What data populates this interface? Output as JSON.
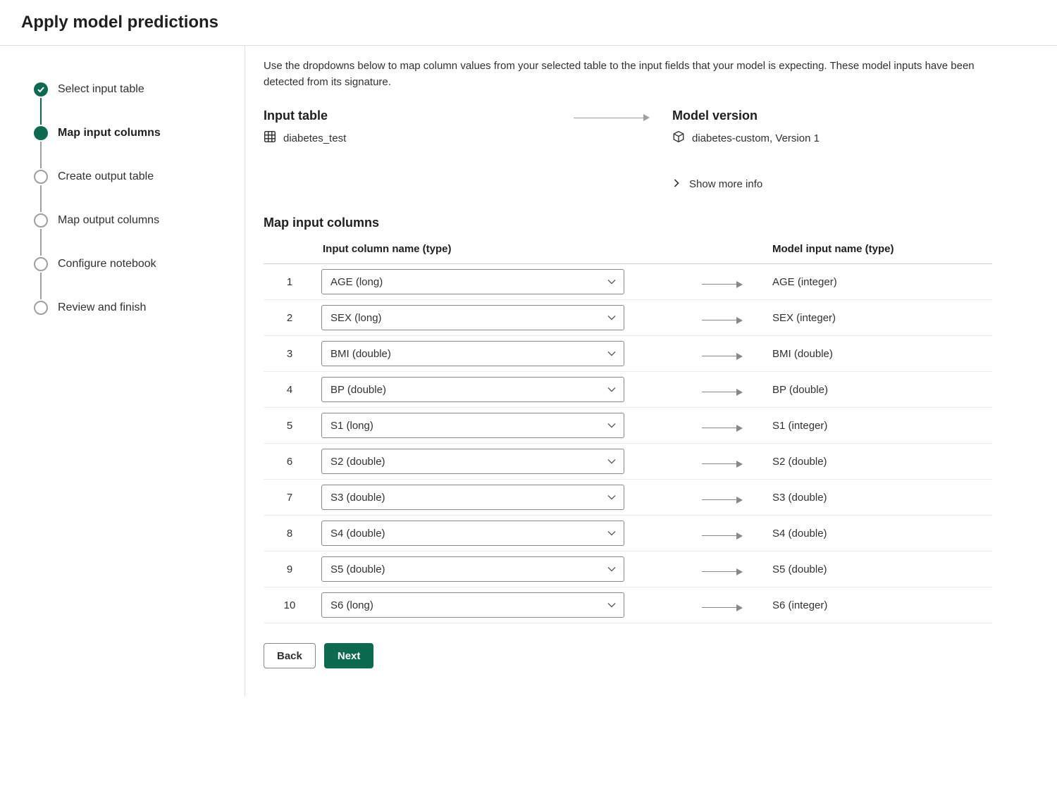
{
  "header": {
    "title": "Apply model predictions"
  },
  "steps": [
    {
      "label": "Select input table",
      "state": "done"
    },
    {
      "label": "Map input columns",
      "state": "active"
    },
    {
      "label": "Create output table",
      "state": "pending"
    },
    {
      "label": "Map output columns",
      "state": "pending"
    },
    {
      "label": "Configure notebook",
      "state": "pending"
    },
    {
      "label": "Review and finish",
      "state": "pending"
    }
  ],
  "intro": "Use the dropdowns below to map column values from your selected table to the input fields that your model is expecting. These model inputs have been detected from its signature.",
  "input_table": {
    "title": "Input table",
    "name": "diabetes_test"
  },
  "model": {
    "title": "Model version",
    "name": "diabetes-custom,  Version 1"
  },
  "show_more": "Show more info",
  "map": {
    "title": "Map input columns",
    "col_input": "Input column name (type)",
    "col_model": "Model input name (type)",
    "rows": [
      {
        "idx": "1",
        "input": "AGE (long)",
        "model": "AGE (integer)"
      },
      {
        "idx": "2",
        "input": "SEX (long)",
        "model": "SEX (integer)"
      },
      {
        "idx": "3",
        "input": "BMI (double)",
        "model": "BMI (double)"
      },
      {
        "idx": "4",
        "input": "BP (double)",
        "model": "BP (double)"
      },
      {
        "idx": "5",
        "input": "S1 (long)",
        "model": "S1 (integer)"
      },
      {
        "idx": "6",
        "input": "S2 (double)",
        "model": "S2 (double)"
      },
      {
        "idx": "7",
        "input": "S3 (double)",
        "model": "S3 (double)"
      },
      {
        "idx": "8",
        "input": "S4 (double)",
        "model": "S4 (double)"
      },
      {
        "idx": "9",
        "input": "S5 (double)",
        "model": "S5 (double)"
      },
      {
        "idx": "10",
        "input": "S6 (long)",
        "model": "S6 (integer)"
      }
    ]
  },
  "buttons": {
    "back": "Back",
    "next": "Next"
  }
}
